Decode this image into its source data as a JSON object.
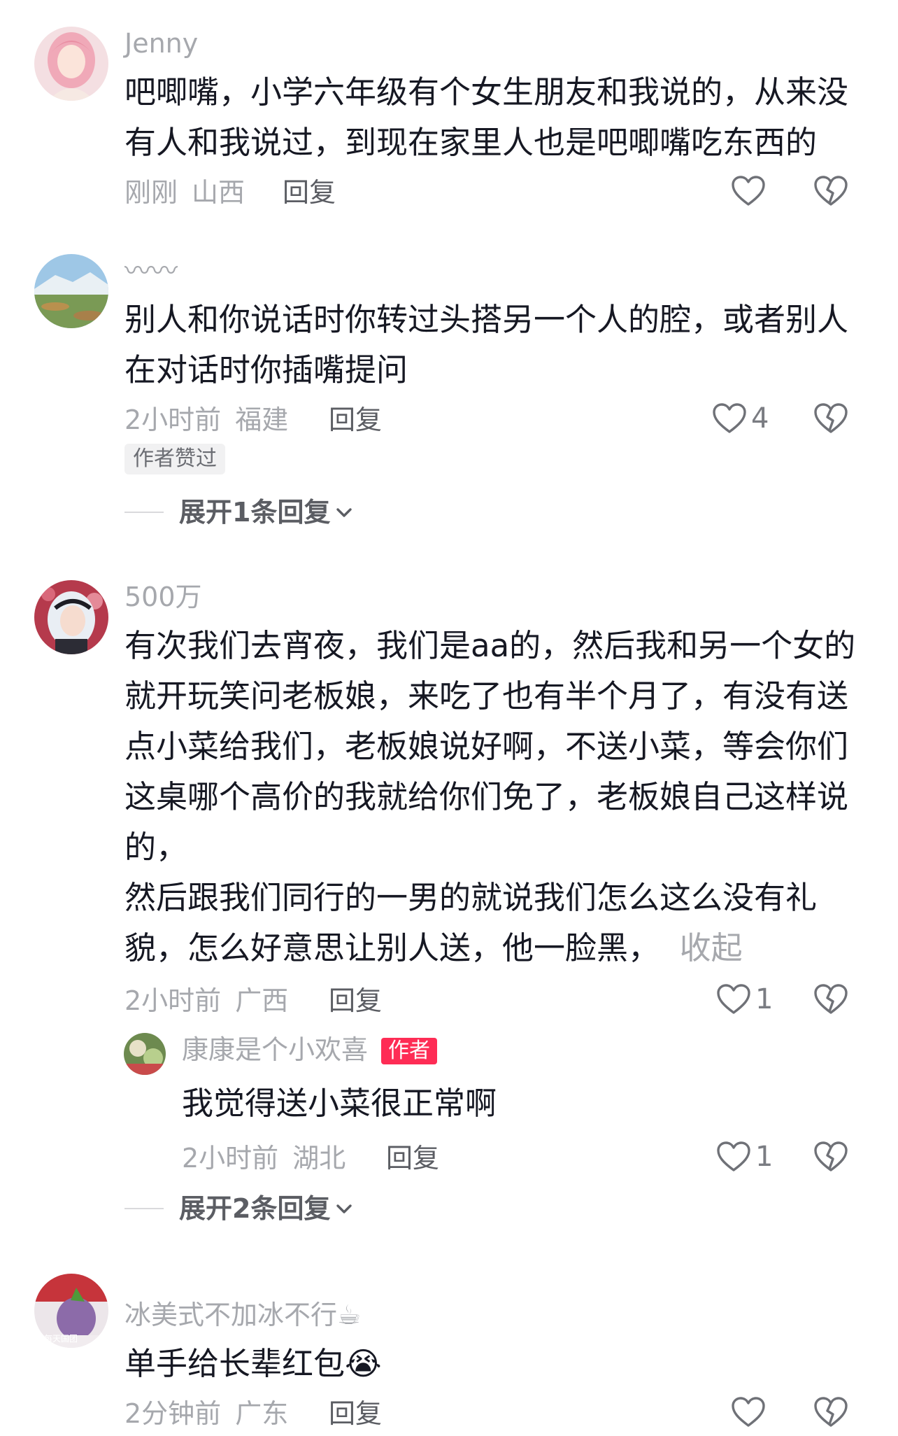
{
  "comments": [
    {
      "username": "Jenny",
      "content": "吧唧嘴，小学六年级有个女生朋友和我说的，从来没\n有人和我说过，到现在家里人也是吧唧嘴吃东西的",
      "time": "刚刚",
      "location": "山西",
      "reply_label": "回复",
      "likes": ""
    },
    {
      "username": "〰〰",
      "content": "别人和你说话时你转过头搭另一个人的腔，或者别人\n在对话时你插嘴提问",
      "time": "2小时前",
      "location": "福建",
      "reply_label": "回复",
      "likes": "4",
      "badge": "作者赞过",
      "expand_label": "展开1条回复"
    },
    {
      "username": "500万",
      "content": "有次我们去宵夜，我们是aa的，然后我和另一个女的\n就开玩笑问老板娘，来吃了也有半个月了，有没有送\n点小菜给我们，老板娘说好啊，不送小菜，等会你们\n这桌哪个高价的我就给你们免了，老板娘自己这样说\n的，\n然后跟我们同行的一男的就说我们怎么这么没有礼\n貌，怎么好意思让别人送，他一脸黑，",
      "collapse_label": "收起",
      "time": "2小时前",
      "location": "广西",
      "reply_label": "回复",
      "likes": "1",
      "reply": {
        "username": "康康是个小欢喜",
        "author_tag": "作者",
        "content": "我觉得送小菜很正常啊",
        "time": "2小时前",
        "location": "湖北",
        "reply_label": "回复",
        "likes": "1"
      },
      "expand_label": "展开2条回复"
    },
    {
      "username": "冰美式不加冰不行☕",
      "content": "单手给长辈红包😭",
      "time": "2分钟前",
      "location": "广东",
      "reply_label": "回复",
      "likes": "",
      "avatar_text": "每天国团"
    }
  ],
  "colors": {
    "text": "#161823",
    "secondary": "#a6a8ad",
    "accent": "#fe2c55"
  }
}
